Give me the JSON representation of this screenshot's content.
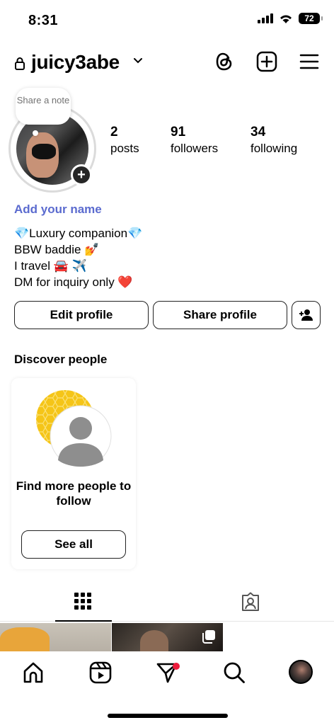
{
  "status_bar": {
    "time": "8:31",
    "battery": "72"
  },
  "header": {
    "username": "juicy3abe"
  },
  "profile": {
    "note_text": "Share a note",
    "stats": [
      {
        "value": "2",
        "label": "posts"
      },
      {
        "value": "91",
        "label": "followers"
      },
      {
        "value": "34",
        "label": "following"
      }
    ],
    "add_name": "Add your name",
    "bio": [
      "💎Luxury companion💎",
      "BBW baddie 💅",
      "I travel 🚘 ✈️",
      "DM for inquiry only ❤️"
    ]
  },
  "buttons": {
    "edit_profile": "Edit profile",
    "share_profile": "Share profile"
  },
  "discover": {
    "heading": "Discover people",
    "card_title": "Find more people to follow",
    "see_all": "See all"
  },
  "colors": {
    "accent_link": "#5b6bcf",
    "notification_dot": "#ed1b3b",
    "honeycomb": "#f5c518"
  },
  "icons": [
    "lock-icon",
    "chevron-down-icon",
    "threads-icon",
    "new-post-icon",
    "menu-icon",
    "add-person-icon",
    "grid-icon",
    "tagged-icon",
    "home-icon",
    "reels-icon",
    "direct-icon",
    "search-icon",
    "profile-avatar-icon"
  ]
}
